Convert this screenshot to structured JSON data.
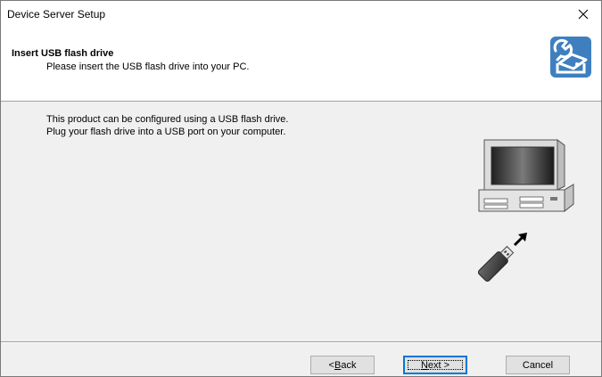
{
  "window": {
    "title": "Device Server Setup",
    "close_glyph": "✕"
  },
  "header": {
    "title": "Insert USB flash drive",
    "subtitle": "Please insert the USB flash drive into your PC.",
    "icon": "usb-drive-wrench-icon",
    "icon_color": "#3f7fc0"
  },
  "body": {
    "line1": "This product can be configured using a USB flash drive.",
    "line2": "Plug your flash drive into a USB port on your computer."
  },
  "illustration": {
    "icon": "computer-with-usb-drive-icon"
  },
  "buttons": {
    "back": {
      "prefix": "< ",
      "accel": "B",
      "rest": "ack"
    },
    "next": {
      "accel": "N",
      "rest": "ext >"
    },
    "cancel": "Cancel"
  },
  "colors": {
    "focus_border": "#0078d7",
    "dialog_bg": "#f0f0f0"
  }
}
